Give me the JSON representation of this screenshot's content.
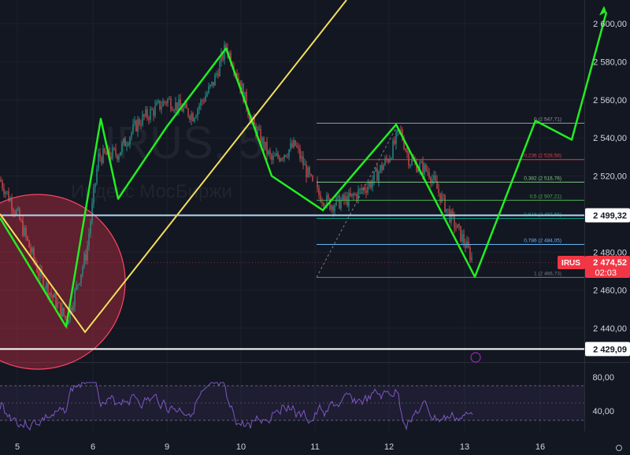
{
  "watermark": {
    "ticker": "IRUS, 5",
    "subtitle": "Индекс МосБиржи"
  },
  "symbol_badge": {
    "label": "IRUS",
    "price": "2 474,52",
    "timer": "02:03",
    "color": "#f23645"
  },
  "price_axis": {
    "ticks": [
      "2 600,00",
      "2 580,00",
      "2 560,00",
      "2 540,00",
      "2 520,00",
      "2 480,00",
      "2 460,00",
      "2 440,00"
    ],
    "values": [
      2600,
      2580,
      2560,
      2540,
      2520,
      2480,
      2460,
      2440
    ],
    "range": [
      2424,
      2612
    ]
  },
  "horizontal_levels": [
    {
      "value": 2499.32,
      "label": "2 499,32",
      "color": "#b2d7f5"
    },
    {
      "value": 2429.09,
      "label": "2 429,09",
      "color": "#ffffff"
    }
  ],
  "fibonacci": [
    {
      "ratio": 0,
      "label": "0 (2 547,71)",
      "value": 2547.71,
      "color": "#9598a1"
    },
    {
      "ratio": 0.236,
      "label": "0,236 (2 528,58)",
      "value": 2528.58,
      "color": "#f23645"
    },
    {
      "ratio": 0.382,
      "label": "0,382 (2 516,76)",
      "value": 2516.76,
      "color": "#81c784"
    },
    {
      "ratio": 0.5,
      "label": "0,5 (2 507,21)",
      "value": 2507.21,
      "color": "#4caf50"
    },
    {
      "ratio": 0.618,
      "label": "0,618 (2 497,65)",
      "value": 2497.65,
      "color": "#089981"
    },
    {
      "ratio": 0.786,
      "label": "0,786 (2 484,05)",
      "value": 2484.05,
      "color": "#64b5f6"
    },
    {
      "ratio": 1,
      "label": "1 (2 466,73)",
      "value": 2466.73,
      "color": "#787b86"
    }
  ],
  "time_axis": {
    "labels": [
      "5",
      "6",
      "9",
      "10",
      "11",
      "12",
      "13",
      "16"
    ]
  },
  "rsi": {
    "ticks": [
      "80,00",
      "40,00"
    ],
    "upper": 70,
    "mid": 50,
    "lower": 30,
    "color": "#7e57c2"
  },
  "chart_data": {
    "type": "line",
    "title": "",
    "series": [
      {
        "x": [
          "5",
          "5-6",
          "6",
          "6",
          "6",
          "9",
          "9-10",
          "10",
          "10-11",
          "11",
          "11-12",
          "12",
          "13",
          "13-16",
          "16",
          "16"
        ],
        "values": [
          2495,
          2470,
          2440,
          2550,
          2508,
          2546,
          2587,
          2555,
          2520,
          2502,
          2524,
          2547,
          2467,
          2509,
          2549,
          2539
        ]
      },
      {
        "x": [
          "6",
          "9",
          "10"
        ],
        "values": [
          2438,
          2494,
          2622
        ]
      }
    ],
    "colors": {
      "zigzag": "#22ee22",
      "trend": "#f3df5b",
      "circle_fill": "rgba(199,46,66,0.42)",
      "circle_stroke": "#ff4466"
    }
  }
}
